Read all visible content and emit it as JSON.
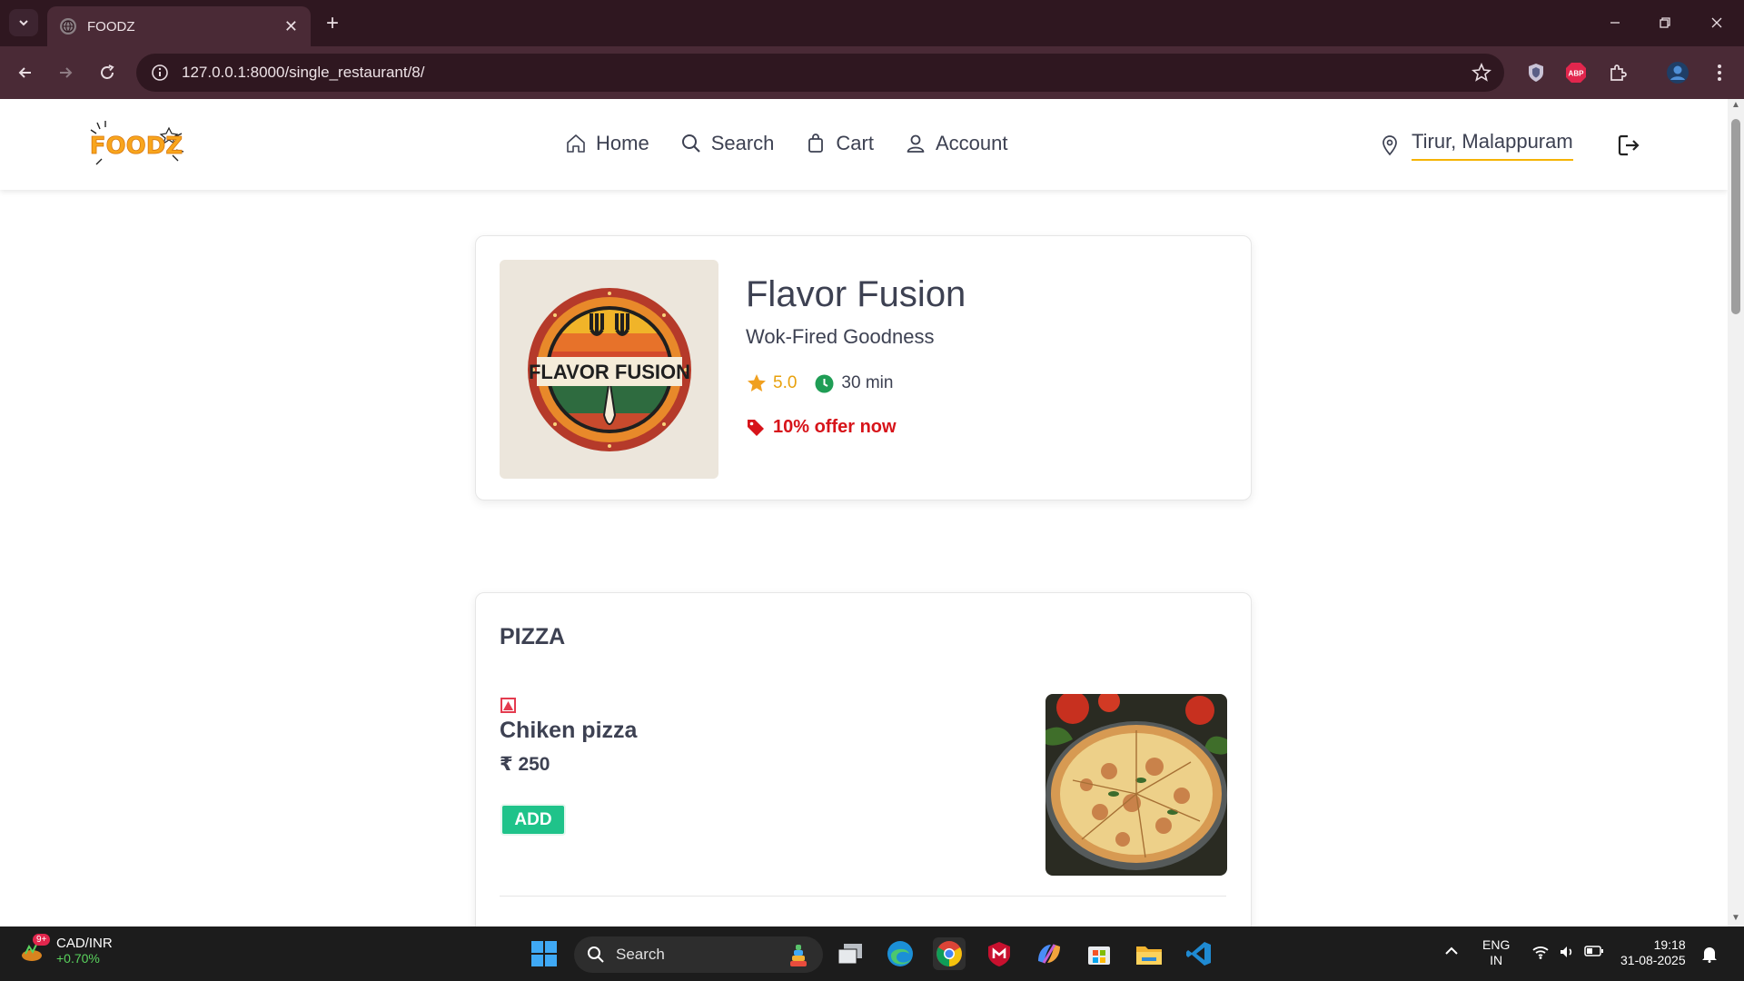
{
  "browser": {
    "tab_title": "FOODZ",
    "url": "127.0.0.1:8000/single_restaurant/8/"
  },
  "site": {
    "logo_text": "FOODZ",
    "nav": [
      {
        "label": "Home",
        "icon": "home-icon"
      },
      {
        "label": "Search",
        "icon": "search-icon"
      },
      {
        "label": "Cart",
        "icon": "shopping-bag-icon"
      },
      {
        "label": "Account",
        "icon": "user-icon"
      }
    ],
    "location": "Tirur, Malappuram"
  },
  "restaurant": {
    "name": "Flavor Fusion",
    "logo_text": "FLAVOR FUSION",
    "tagline": "Wok-Fired Goodness",
    "rating": "5.0",
    "delivery_time": "30 min",
    "offer": "10% offer now"
  },
  "menu": {
    "section": "PIZZA",
    "items": [
      {
        "name": "Chiken pizza",
        "price": "₹ 250",
        "add_label": "ADD"
      }
    ]
  },
  "taskbar": {
    "ticker_symbol": "CAD/INR",
    "ticker_change": "+0.70%",
    "ticker_badge": "9+",
    "search_label": "Search",
    "lang_top": "ENG",
    "lang_bottom": "IN",
    "time": "19:18",
    "date": "31-08-2025"
  },
  "colors": {
    "brand_yellow": "#f5b301",
    "add_green": "#1fc38a",
    "offer_red": "#d7141a",
    "rating_orange": "#e8a10c",
    "chrome_dark": "#2f1720",
    "chrome_mid": "#4a2a36"
  }
}
